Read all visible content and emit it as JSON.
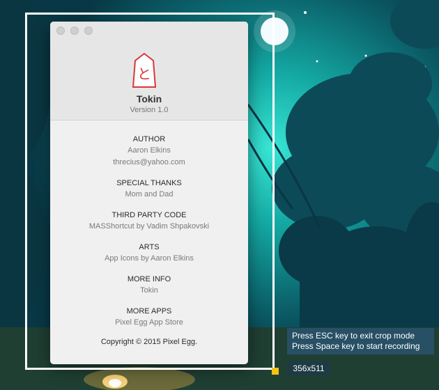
{
  "about": {
    "app_name": "Tokin",
    "version": "Version 1.0",
    "icon_glyph": "と",
    "sections": [
      {
        "title": "AUTHOR",
        "lines": [
          "Aaron Elkins",
          "threcius@yahoo.com"
        ]
      },
      {
        "title": "SPECIAL THANKS",
        "lines": [
          "Mom and Dad"
        ]
      },
      {
        "title": "THIRD PARTY CODE",
        "lines": [
          "MASShortcut by Vadim Shpakovski"
        ]
      },
      {
        "title": "ARTS",
        "lines": [
          "App Icons by Aaron Elkins"
        ]
      },
      {
        "title": "MORE INFO",
        "lines": [
          "Tokin"
        ]
      },
      {
        "title": "MORE APPS",
        "lines": [
          "Pixel Egg App Store"
        ]
      }
    ],
    "copyright": "Copyright © 2015 Pixel Egg."
  },
  "crop": {
    "hint_line1": "Press ESC key to exit crop mode",
    "hint_line2": "Press Space key to start recording",
    "size_label": "356x511"
  },
  "colors": {
    "crop_handle": "#f3c316",
    "icon_red": "#d8373a"
  }
}
